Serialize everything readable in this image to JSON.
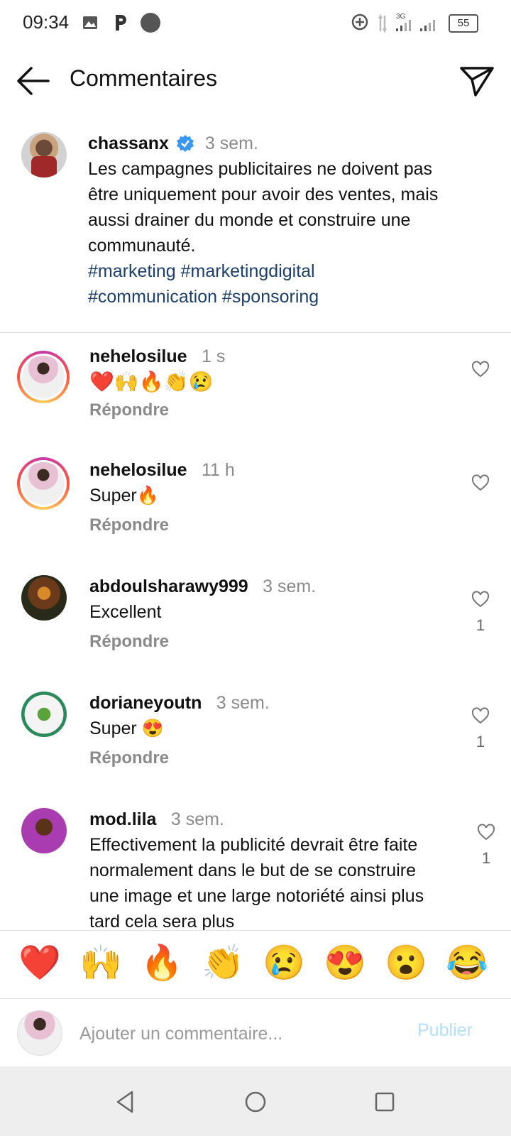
{
  "status_bar": {
    "time": "09:34",
    "battery": "55",
    "network": "3G"
  },
  "header": {
    "title": "Commentaires"
  },
  "caption": {
    "username": "chassanx",
    "time": "3 sem.",
    "text": "Les campagnes publicitaires ne doivent pas être uniquement pour avoir des ventes, mais aussi drainer du monde et construire une communauté.",
    "hashtags_line1": "#marketing #marketingdigital",
    "hashtags_line2": "#communication #sponsoring"
  },
  "comments": [
    {
      "username": "nehelosilue",
      "time": "1 s",
      "text": "❤️🙌🔥👏😢",
      "reply": "Répondre",
      "likes": ""
    },
    {
      "username": "nehelosilue",
      "time": "11 h",
      "text": "Super🔥",
      "reply": "Répondre",
      "likes": ""
    },
    {
      "username": "abdoulsharawy999",
      "time": "3 sem.",
      "text": "Excellent",
      "reply": "Répondre",
      "likes": "1"
    },
    {
      "username": "dorianeyoutn",
      "time": "3 sem.",
      "text": "Super 😍",
      "reply": "Répondre",
      "likes": "1"
    },
    {
      "username": "mod.lila",
      "time": "3 sem.",
      "text": "Effectivement la publicité devrait être faite normalement dans le but de se construire une image et une large notoriété ainsi plus tard cela sera plus",
      "reply": "",
      "likes": "1"
    }
  ],
  "emoji_bar": [
    "❤️",
    "🙌",
    "🔥",
    "👏",
    "😢",
    "😍",
    "😮",
    "😂"
  ],
  "composer": {
    "placeholder": "Ajouter un commentaire...",
    "publish_label": "Publier"
  },
  "colors": {
    "hashtag": "#1c3f6e",
    "verified": "#3897f0",
    "publish_disabled": "#b2dffc",
    "secondary_text": "#8a8a8a"
  }
}
